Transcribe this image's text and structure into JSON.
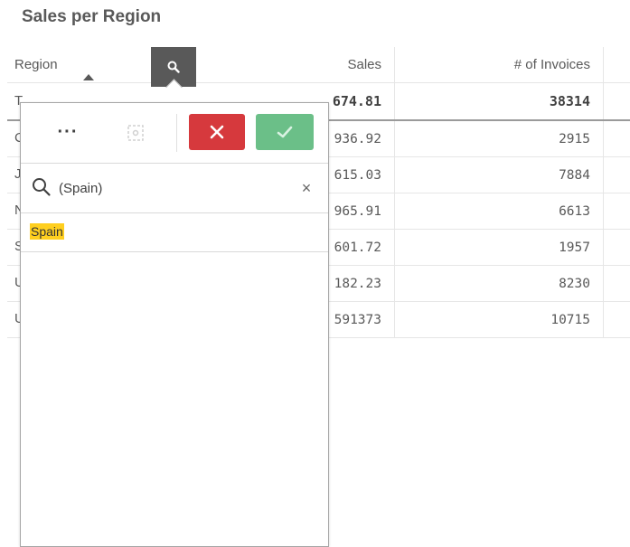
{
  "title": "Sales per Region",
  "table": {
    "headers": {
      "region": "Region",
      "sales": "Sales",
      "invoices": "# of Invoices"
    },
    "total": {
      "region_stub": "T",
      "sales": "674.81",
      "invoices": "38314"
    },
    "rows": [
      {
        "region_stub": "C",
        "sales": "936.92",
        "invoices": "2915"
      },
      {
        "region_stub": "J",
        "sales": "615.03",
        "invoices": "7884"
      },
      {
        "region_stub": "N",
        "sales": "965.91",
        "invoices": "6613"
      },
      {
        "region_stub": "S",
        "sales": "601.72",
        "invoices": "1957"
      },
      {
        "region_stub": "U",
        "sales": "182.23",
        "invoices": "8230"
      },
      {
        "region_stub": "U",
        "sales": "591373",
        "invoices": "10715"
      }
    ]
  },
  "popover": {
    "more_label": "···",
    "search_value": "(Spain)",
    "clear_label": "×",
    "results": [
      {
        "label": "Spain"
      }
    ]
  },
  "colors": {
    "cancel": "#d6393d",
    "confirm": "#6bbf88",
    "highlight": "#ffcf1f",
    "header_button": "#595959"
  },
  "icons": {
    "header_search": "search-icon",
    "cancel": "close-icon",
    "confirm": "check-icon",
    "dim": "selection-icon"
  }
}
